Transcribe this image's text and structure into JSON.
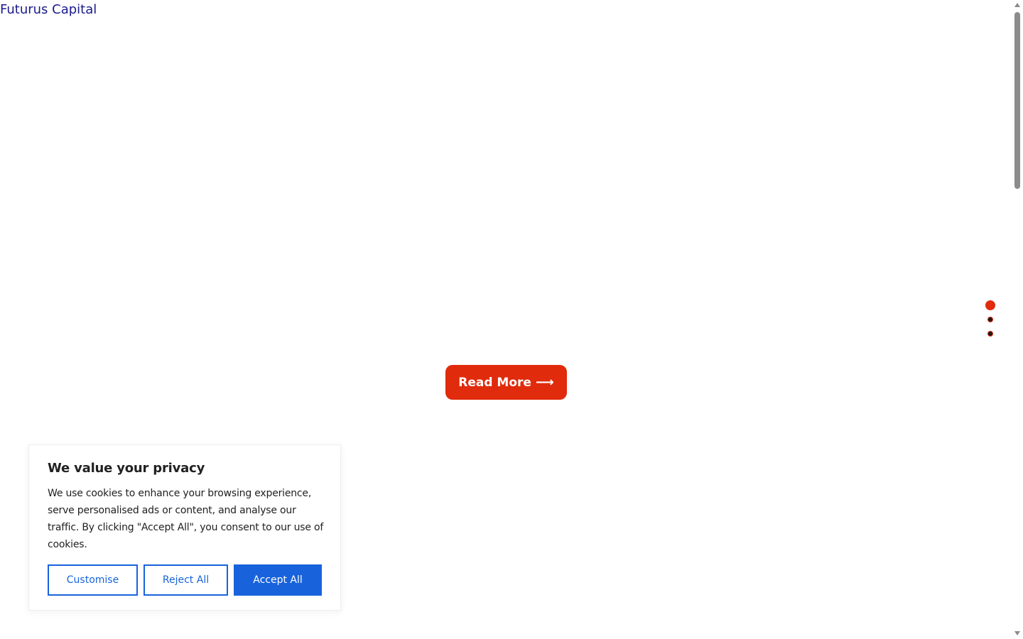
{
  "header": {
    "brand": "Futurus Capital"
  },
  "hero": {
    "cta_label": "Read More",
    "cta_icon": "arrow-right-icon"
  },
  "slider": {
    "dots": 3,
    "active": 1
  },
  "cookie_banner": {
    "title": "We value your privacy",
    "text": "We use cookies to enhance your browsing experience, serve personalised ads or content, and analyse our traffic. By clicking \"Accept All\", you consent to our use of cookies.",
    "customise_label": "Customise",
    "reject_label": "Reject All",
    "accept_label": "Accept All"
  },
  "colors": {
    "accent": "#e02b0c",
    "primary": "#1863dc",
    "brand_text": "#1a1a8c"
  }
}
